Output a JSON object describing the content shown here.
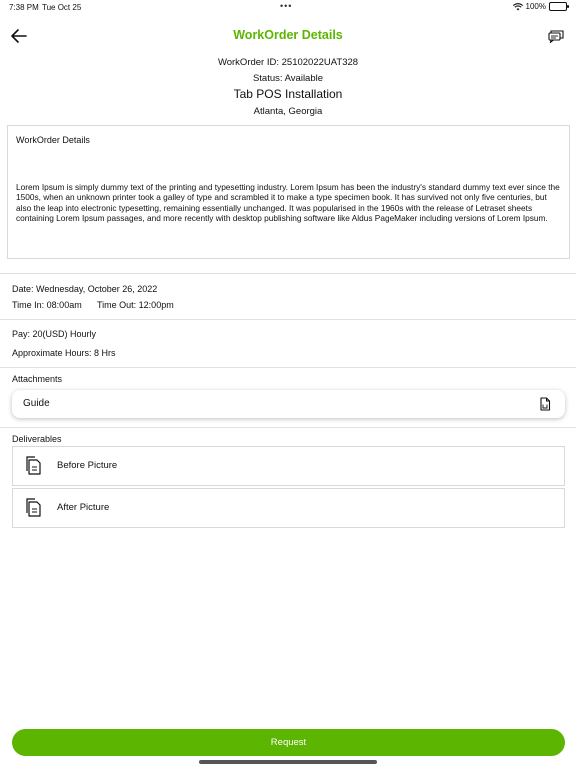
{
  "status_bar": {
    "time": "7:38 PM",
    "date": "Tue Oct 25",
    "dots": "•••",
    "battery": "100%"
  },
  "nav": {
    "title": "WorkOrder Details"
  },
  "header": {
    "workorder_id": "WorkOrder ID: 25102022UAT328",
    "status": "Status: Available",
    "name": "Tab POS Installation",
    "location": "Atlanta, Georgia"
  },
  "description": {
    "label": "WorkOrder Details",
    "text": "Lorem Ipsum is simply dummy text of the printing and typesetting industry. Lorem Ipsum has been the industry's standard dummy text ever since the 1500s, when an unknown printer took a galley of type and scrambled it to make a type specimen book. It has survived not only five centuries, but also the leap into electronic typesetting, remaining essentially unchanged. It was popularised in the 1960s with the release of Letraset sheets containing Lorem Ipsum passages, and more recently with desktop publishing software like Aldus PageMaker including versions of Lorem Ipsum."
  },
  "schedule": {
    "date": "Date: Wednesday, October 26, 2022",
    "time_in": "Time In: 08:00am",
    "time_out": "Time Out: 12:00pm"
  },
  "pay": {
    "rate": "Pay: 20(USD) Hourly",
    "hours": "Approximate Hours: 8 Hrs"
  },
  "attachments": {
    "heading": "Attachments",
    "items": [
      {
        "label": "Guide",
        "icon": "file-icon"
      }
    ]
  },
  "deliverables": {
    "heading": "Deliverables",
    "items": [
      {
        "label": "Before Picture",
        "icon": "document-icon"
      },
      {
        "label": "After Picture",
        "icon": "document-icon"
      }
    ]
  },
  "actions": {
    "request_label": "Request"
  },
  "colors": {
    "accent": "#5cb500"
  }
}
